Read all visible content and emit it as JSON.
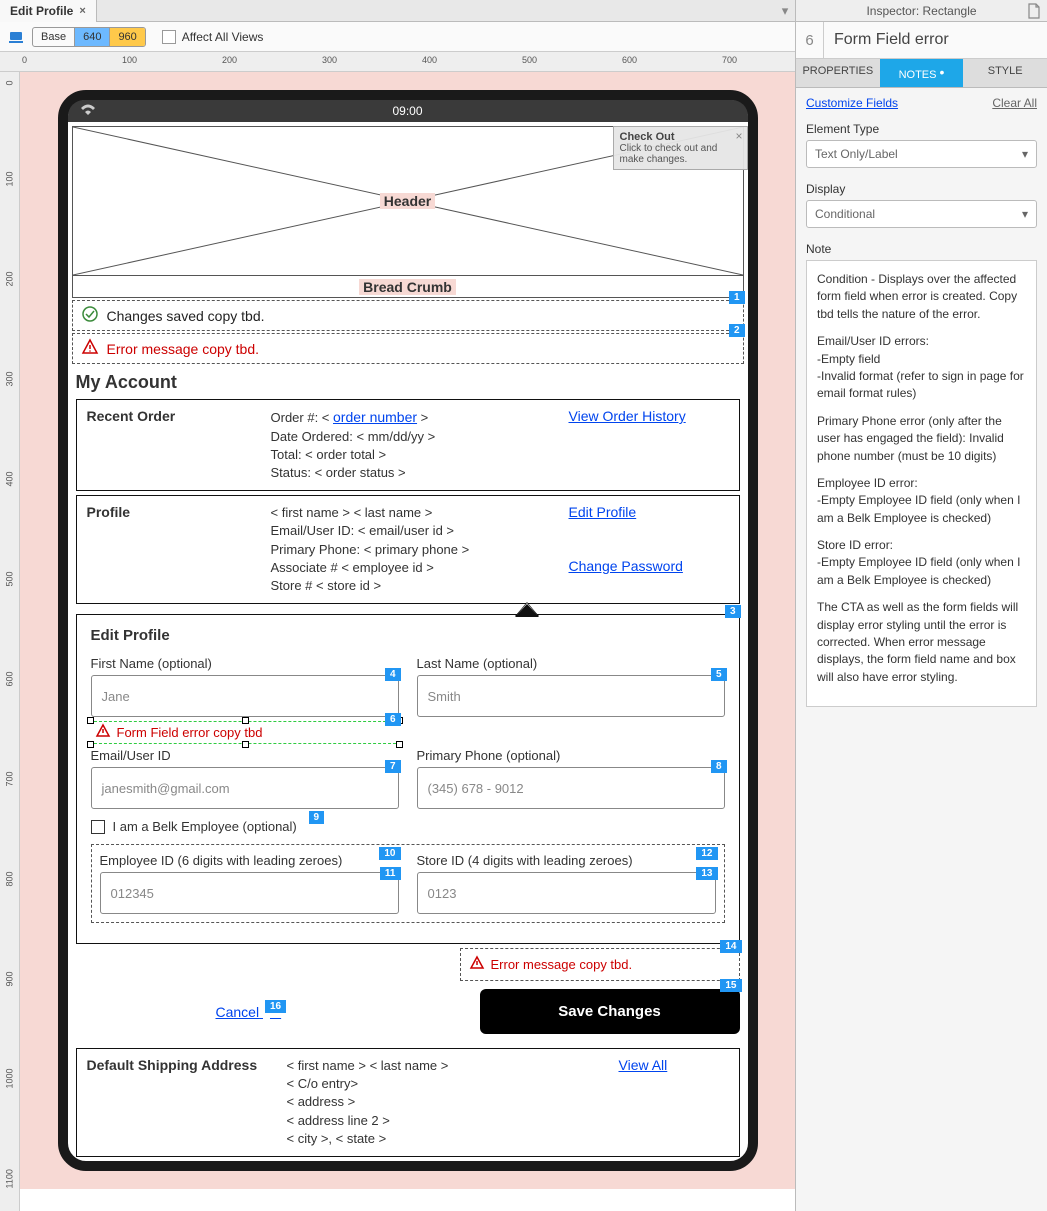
{
  "tab": {
    "title": "Edit Profile"
  },
  "toolbar": {
    "base": "Base",
    "bp640": "640",
    "bp960": "960",
    "affect_all": "Affect All Views"
  },
  "ruler_h": [
    "0",
    "100",
    "200",
    "300",
    "400",
    "500",
    "600",
    "700"
  ],
  "ruler_v": [
    "0",
    "100",
    "200",
    "300",
    "400",
    "500",
    "600",
    "700",
    "800",
    "900",
    "1000",
    "1100"
  ],
  "device": {
    "time": "09:00",
    "header": "Header",
    "breadcrumb": "Bread Crumb",
    "success_msg": "Changes saved copy tbd.",
    "error_msg": "Error message copy tbd.",
    "section_title": "My Account"
  },
  "checkout": {
    "title": "Check Out",
    "body": "Click to check out and make changes."
  },
  "recent": {
    "title": "Recent Order",
    "order_line": "Order #:  < ",
    "order_link": "order number",
    "order_end": " >",
    "date": "Date Ordered:  < mm/dd/yy >",
    "total": "Total:  < order total >",
    "status": "Status:  <  order status >",
    "view_history": "View Order History"
  },
  "profile": {
    "title": "Profile",
    "name": "< first name >  < last name >",
    "email": "Email/User ID: < email/user id >",
    "phone": "Primary Phone:   < primary phone >",
    "assoc": "Associate #    < employee id >",
    "store": "Store #   < store id >",
    "edit_link": "Edit Profile",
    "change_pw": "Change Password"
  },
  "edit": {
    "title": "Edit Profile",
    "first_label": "First Name (optional)",
    "first_ph": "Jane",
    "last_label": "Last Name (optional)",
    "last_ph": "Smith",
    "field_error": "Form Field error copy tbd",
    "email_label": "Email/User ID",
    "email_ph": "janesmith@gmail.com",
    "phone_label": "Primary Phone (optional)",
    "phone_ph": "(345) 678 - 9012",
    "belk_label": "I am a Belk Employee (optional)",
    "emp_label": "Employee ID (6 digits with leading zeroes)",
    "emp_ph": "012345",
    "store_label": "Store ID (4 digits with leading zeroes)",
    "store_ph": "0123",
    "err2": "Error message copy tbd.",
    "cancel": "Cancel",
    "save": "Save Changes"
  },
  "markers": {
    "m1": "1",
    "m2": "2",
    "m3": "3",
    "m4": "4",
    "m5": "5",
    "m6": "6",
    "m7": "7",
    "m8": "8",
    "m9": "9",
    "m10": "10",
    "m11": "11",
    "m12": "12",
    "m13": "13",
    "m14": "14",
    "m15": "15",
    "m16": "16"
  },
  "shipping": {
    "title": "Default Shipping Address",
    "l1": "< first name > < last name >",
    "l2": "< C/o entry>",
    "l3": "< address >",
    "l4": "< address line 2 >",
    "l5": "< city >, < state >",
    "view_all": "View All"
  },
  "inspector": {
    "top": "Inspector: Rectangle",
    "num": "6",
    "title": "Form Field error",
    "tabs": {
      "properties": "PROPERTIES",
      "notes": "NOTES",
      "style": "STYLE"
    },
    "customize": "Customize Fields",
    "clear": "Clear All",
    "element_type_label": "Element Type",
    "element_type": "Text Only/Label",
    "display_label": "Display",
    "display": "Conditional",
    "note_label": "Note",
    "note_p1": "Condition - Displays over the affected form field when error is created. Copy tbd tells the nature of the error.",
    "note_p2": "Email/User ID errors:\n-Empty field\n-Invalid format (refer to sign in page for email format rules)",
    "note_p3": "Primary Phone error (only after the user has engaged the field): Invalid phone number (must be 10 digits)",
    "note_p4": "Employee ID error:\n-Empty Employee ID field (only when I am a Belk Employee is checked)",
    "note_p5": "Store ID error:\n-Empty Employee ID field (only when I am a Belk Employee is checked)",
    "note_p6": "The CTA as well as the form fields will display error styling until the error is corrected.  When error message displays, the form field name and box will also have error styling."
  }
}
